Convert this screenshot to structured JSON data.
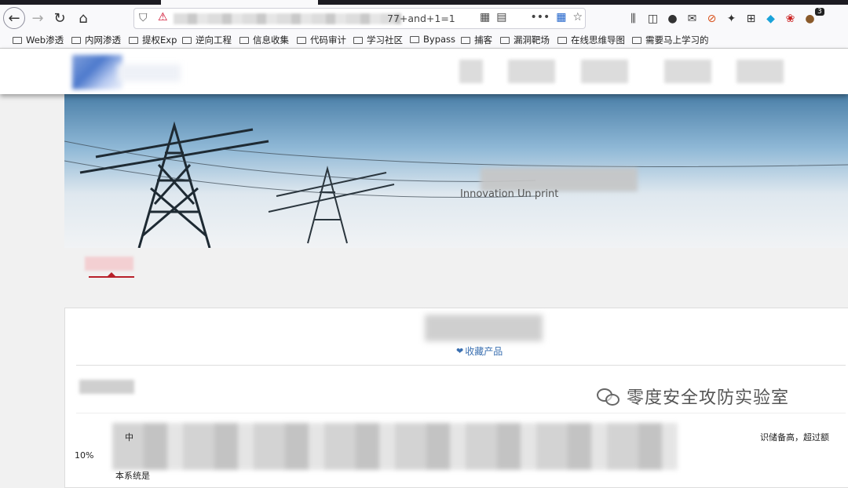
{
  "browser": {
    "url_visible_tail": "77+and+1=1",
    "extension_badge_count": "3",
    "bookmarks": [
      "Web渗透",
      "内网渗透",
      "提权Exp",
      "逆向工程",
      "信息收集",
      "代码审计",
      "学习社区",
      "Bypass",
      "捕客",
      "漏洞靶场",
      "在线思维导图",
      "需要马上学习的"
    ]
  },
  "page": {
    "banner_tagline_fragment": "Innovation  Un           print",
    "favorite_link": "收藏产品",
    "body_fragments": {
      "f1": "中",
      "f2": "10%",
      "f3": "本系统是",
      "f4": "识储备高，超过额"
    }
  },
  "watermark": {
    "text": "零度安全攻防实验室"
  }
}
